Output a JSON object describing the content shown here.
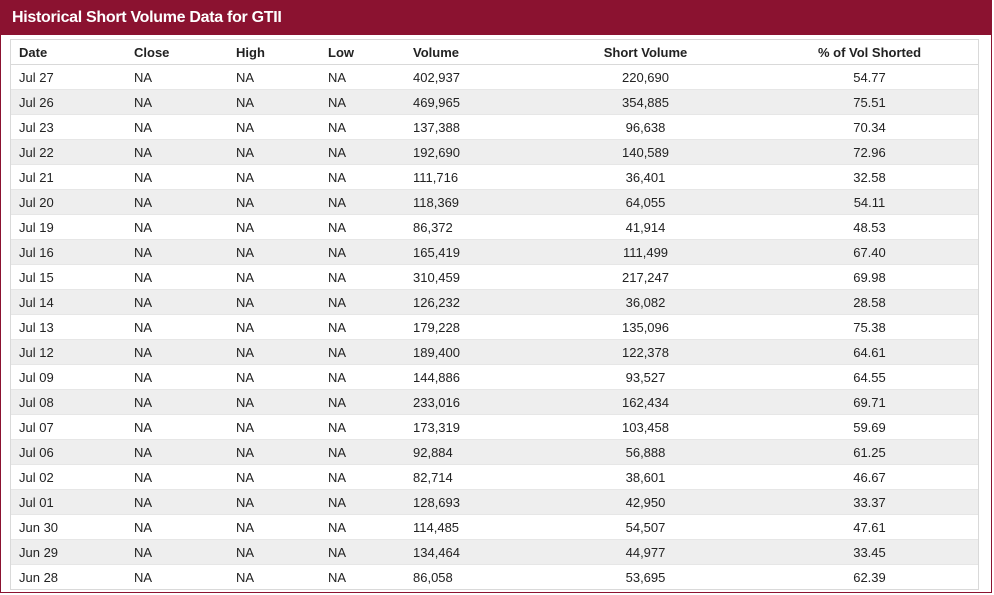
{
  "header": {
    "title": "Historical Short Volume Data for GTII"
  },
  "table": {
    "columns": [
      "Date",
      "Close",
      "High",
      "Low",
      "Volume",
      "Short Volume",
      "% of Vol Shorted"
    ],
    "rows": [
      [
        "Jul 27",
        "NA",
        "NA",
        "NA",
        "402,937",
        "220,690",
        "54.77"
      ],
      [
        "Jul 26",
        "NA",
        "NA",
        "NA",
        "469,965",
        "354,885",
        "75.51"
      ],
      [
        "Jul 23",
        "NA",
        "NA",
        "NA",
        "137,388",
        "96,638",
        "70.34"
      ],
      [
        "Jul 22",
        "NA",
        "NA",
        "NA",
        "192,690",
        "140,589",
        "72.96"
      ],
      [
        "Jul 21",
        "NA",
        "NA",
        "NA",
        "111,716",
        "36,401",
        "32.58"
      ],
      [
        "Jul 20",
        "NA",
        "NA",
        "NA",
        "118,369",
        "64,055",
        "54.11"
      ],
      [
        "Jul 19",
        "NA",
        "NA",
        "NA",
        "86,372",
        "41,914",
        "48.53"
      ],
      [
        "Jul 16",
        "NA",
        "NA",
        "NA",
        "165,419",
        "111,499",
        "67.40"
      ],
      [
        "Jul 15",
        "NA",
        "NA",
        "NA",
        "310,459",
        "217,247",
        "69.98"
      ],
      [
        "Jul 14",
        "NA",
        "NA",
        "NA",
        "126,232",
        "36,082",
        "28.58"
      ],
      [
        "Jul 13",
        "NA",
        "NA",
        "NA",
        "179,228",
        "135,096",
        "75.38"
      ],
      [
        "Jul 12",
        "NA",
        "NA",
        "NA",
        "189,400",
        "122,378",
        "64.61"
      ],
      [
        "Jul 09",
        "NA",
        "NA",
        "NA",
        "144,886",
        "93,527",
        "64.55"
      ],
      [
        "Jul 08",
        "NA",
        "NA",
        "NA",
        "233,016",
        "162,434",
        "69.71"
      ],
      [
        "Jul 07",
        "NA",
        "NA",
        "NA",
        "173,319",
        "103,458",
        "59.69"
      ],
      [
        "Jul 06",
        "NA",
        "NA",
        "NA",
        "92,884",
        "56,888",
        "61.25"
      ],
      [
        "Jul 02",
        "NA",
        "NA",
        "NA",
        "82,714",
        "38,601",
        "46.67"
      ],
      [
        "Jul 01",
        "NA",
        "NA",
        "NA",
        "128,693",
        "42,950",
        "33.37"
      ],
      [
        "Jun 30",
        "NA",
        "NA",
        "NA",
        "114,485",
        "54,507",
        "47.61"
      ],
      [
        "Jun 29",
        "NA",
        "NA",
        "NA",
        "134,464",
        "44,977",
        "33.45"
      ],
      [
        "Jun 28",
        "NA",
        "NA",
        "NA",
        "86,058",
        "53,695",
        "62.39"
      ]
    ]
  },
  "colors": {
    "header_bg": "#8b1230",
    "header_text": "#ffffff",
    "row_alt": "#eeeeee"
  }
}
